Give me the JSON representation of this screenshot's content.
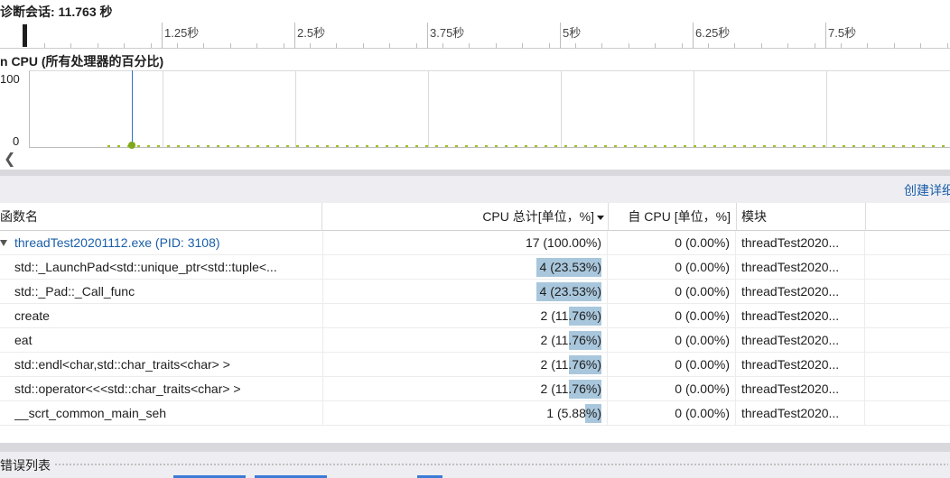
{
  "session": {
    "title": "诊断会话: 11.763 秒"
  },
  "ruler": {
    "ticks": [
      "1.25秒",
      "2.5秒",
      "3.75秒",
      "5秒",
      "6.25秒",
      "7.5秒"
    ]
  },
  "cpu_graph": {
    "title": "n CPU (所有处理器的百分比)",
    "y_max_label": "100",
    "y_min_label": "0",
    "line_color": "#9bc02a",
    "cursor_color": "#2e74c4"
  },
  "toolbar": {
    "details_link": "创建详细"
  },
  "grid": {
    "headers": {
      "name": "函数名",
      "total": "CPU 总计[单位，%]",
      "self": "自 CPU [单位，%]",
      "module": "模块"
    },
    "rows": [
      {
        "name": "threadTest20201112.exe (PID: 3108)",
        "total": "17 (100.00%)",
        "total_pct": 100.0,
        "self": "0 (0.00%)",
        "module": "threadTest2020...",
        "root": true
      },
      {
        "name": "std::_LaunchPad<std::unique_ptr<std::tuple<...",
        "total": "4 (23.53%)",
        "total_pct": 23.53,
        "self": "0 (0.00%)",
        "module": "threadTest2020..."
      },
      {
        "name": "std::_Pad::_Call_func",
        "total": "4 (23.53%)",
        "total_pct": 23.53,
        "self": "0 (0.00%)",
        "module": "threadTest2020..."
      },
      {
        "name": "create",
        "total": "2 (11.76%)",
        "total_pct": 11.76,
        "self": "0 (0.00%)",
        "module": "threadTest2020..."
      },
      {
        "name": "eat",
        "total": "2 (11.76%)",
        "total_pct": 11.76,
        "self": "0 (0.00%)",
        "module": "threadTest2020..."
      },
      {
        "name": "std::endl<char,std::char_traits<char> >",
        "total": "2 (11.76%)",
        "total_pct": 11.76,
        "self": "0 (0.00%)",
        "module": "threadTest2020..."
      },
      {
        "name": "std::operator<<<std::char_traits<char> >",
        "total": "2 (11.76%)",
        "total_pct": 11.76,
        "self": "0 (0.00%)",
        "module": "threadTest2020..."
      },
      {
        "name": "__scrt_common_main_seh",
        "total": "1 (5.88%)",
        "total_pct": 5.88,
        "self": "0 (0.00%)",
        "module": "threadTest2020..."
      }
    ]
  },
  "error_list": {
    "title": "错误列表"
  }
}
